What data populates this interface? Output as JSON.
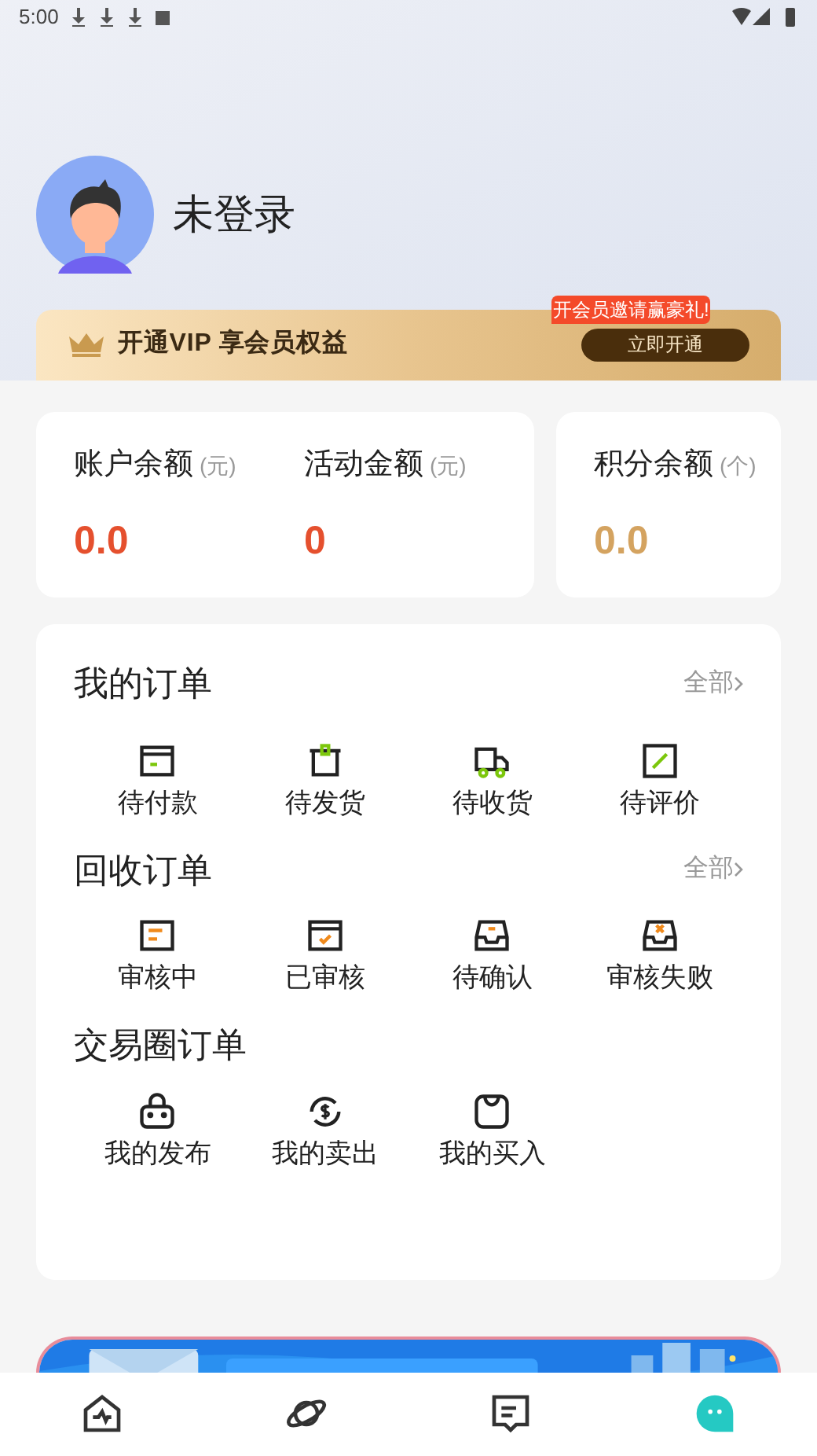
{
  "status_bar": {
    "time": "5:00"
  },
  "profile": {
    "name": "未登录"
  },
  "vip": {
    "text": "开通VIP 享会员权益",
    "button": "立即开通",
    "badge": "开会员邀请赢豪礼!"
  },
  "balances": [
    {
      "label": "账户余额",
      "unit": "(元)",
      "value": "0.0",
      "color": "#e5502e"
    },
    {
      "label": "活动金额",
      "unit": "(元)",
      "value": "0",
      "color": "#e5502e"
    }
  ],
  "points": {
    "label": "积分余额",
    "unit": "(个)",
    "value": "0.0",
    "color": "#d4a360"
  },
  "sections": [
    {
      "title": "我的订单",
      "more": "全部",
      "items": [
        {
          "label": "待付款"
        },
        {
          "label": "待发货"
        },
        {
          "label": "待收货"
        },
        {
          "label": "待评价"
        }
      ]
    },
    {
      "title": "回收订单",
      "more": "全部",
      "items": [
        {
          "label": "审核中"
        },
        {
          "label": "已审核"
        },
        {
          "label": "待确认"
        },
        {
          "label": "审核失败"
        }
      ]
    },
    {
      "title": "交易圈订单",
      "items": [
        {
          "label": "我的发布"
        },
        {
          "label": "我的卖出"
        },
        {
          "label": "我的买入"
        }
      ]
    }
  ],
  "nav": [
    {
      "selected": false
    },
    {
      "selected": false
    },
    {
      "selected": false
    },
    {
      "selected": true
    }
  ]
}
